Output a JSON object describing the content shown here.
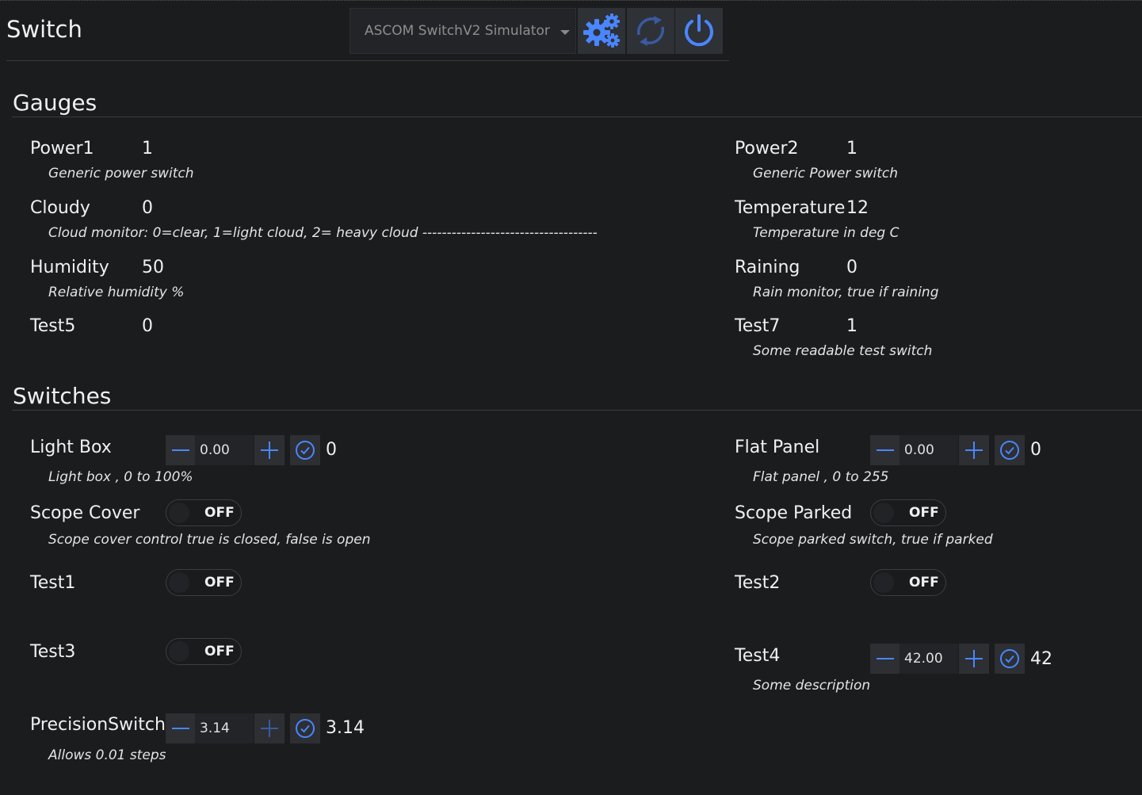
{
  "header": {
    "title": "Switch",
    "device": "ASCOM SwitchV2 Simulator D",
    "setup_icon": "gears-icon",
    "refresh_icon": "refresh-icon",
    "power_icon": "power-icon",
    "accent": "#4a86ff"
  },
  "gauges": {
    "title": "Gauges",
    "items": [
      {
        "name": "Power1",
        "value": "1",
        "desc": "Generic power switch"
      },
      {
        "name": "Power2",
        "value": "1",
        "desc": "Generic Power switch"
      },
      {
        "name": "Cloudy",
        "value": "0",
        "desc": "Cloud monitor: 0=clear, 1=light cloud, 2= heavy cloud ------------------------------------"
      },
      {
        "name": "Temperature",
        "value": "12",
        "desc": "Temperature in deg C"
      },
      {
        "name": "Humidity",
        "value": "50",
        "desc": "Relative humidity %"
      },
      {
        "name": "Raining",
        "value": "0",
        "desc": "Rain monitor, true if raining"
      },
      {
        "name": "Test5",
        "value": "0",
        "desc": ""
      },
      {
        "name": "Test7",
        "value": "1",
        "desc": "Some readable test switch"
      }
    ]
  },
  "switches": {
    "title": "Switches",
    "items": [
      {
        "name": "Light Box",
        "kind": "stepper",
        "input": "0.00",
        "value": "0",
        "desc": "Light box , 0 to 100%"
      },
      {
        "name": "Flat Panel",
        "kind": "stepper",
        "input": "0.00",
        "value": "0",
        "desc": "Flat panel , 0 to 255"
      },
      {
        "name": "Scope Cover",
        "kind": "toggle",
        "state": "OFF",
        "desc": "Scope cover control true is closed, false is open"
      },
      {
        "name": "Scope Parked",
        "kind": "toggle",
        "state": "OFF",
        "desc": "Scope parked switch, true if parked"
      },
      {
        "name": "Test1",
        "kind": "toggle",
        "state": "OFF",
        "desc": ""
      },
      {
        "name": "Test2",
        "kind": "toggle",
        "state": "OFF",
        "desc": ""
      },
      {
        "name": "Test3",
        "kind": "toggle",
        "state": "OFF",
        "desc": ""
      },
      {
        "name": "Test4",
        "kind": "stepper",
        "input": "42.00",
        "value": "42",
        "desc": "Some description"
      },
      {
        "name": "PrecisionSwitch",
        "kind": "stepper",
        "input": "3.14",
        "value": "3.14",
        "desc": "Allows 0.01 steps"
      }
    ]
  }
}
